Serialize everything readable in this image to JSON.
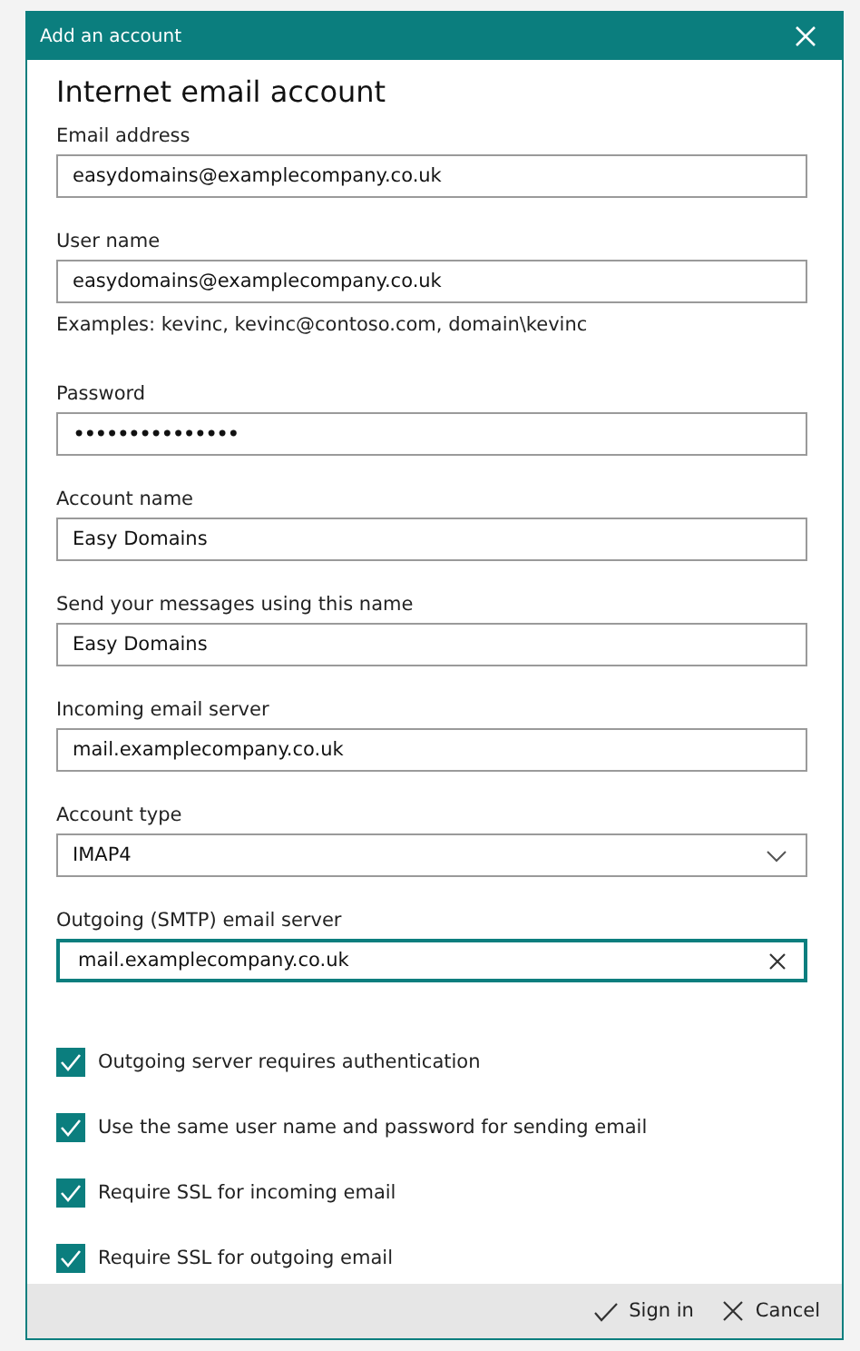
{
  "dialog": {
    "title": "Add an account",
    "heading": "Internet email account"
  },
  "fields": [
    {
      "label": "Email address",
      "kind": "text",
      "value": "easydomains@examplecompany.co.uk",
      "focused": false
    },
    {
      "label": "User name",
      "kind": "text",
      "value": "easydomains@examplecompany.co.uk",
      "focused": false,
      "note": "Examples: kevinc, kevinc@contoso.com, domain\\kevinc"
    },
    {
      "label": "Password",
      "kind": "password",
      "value": "•••••••••••••••",
      "focused": false
    },
    {
      "label": "Account name",
      "kind": "text",
      "value": "Easy Domains",
      "focused": false
    },
    {
      "label": "Send your messages using this name",
      "kind": "text",
      "value": "Easy Domains",
      "focused": false
    },
    {
      "label": "Incoming email server",
      "kind": "text",
      "value": "mail.examplecompany.co.uk",
      "focused": false
    },
    {
      "label": "Account type",
      "kind": "select",
      "value": "IMAP4",
      "focused": false
    },
    {
      "label": "Outgoing (SMTP) email server",
      "kind": "clearable",
      "value": "mail.examplecompany.co.uk",
      "focused": true
    }
  ],
  "options": [
    {
      "label": "Outgoing server requires authentication",
      "checked": true
    },
    {
      "label": "Use the same user name and password for sending email",
      "checked": true
    },
    {
      "label": "Require SSL for incoming email",
      "checked": true
    },
    {
      "label": "Require SSL for outgoing email",
      "checked": true
    }
  ],
  "buttons": [
    {
      "label": "Sign in",
      "kind": "confirm"
    },
    {
      "label": "Cancel",
      "kind": "cancel"
    }
  ]
}
